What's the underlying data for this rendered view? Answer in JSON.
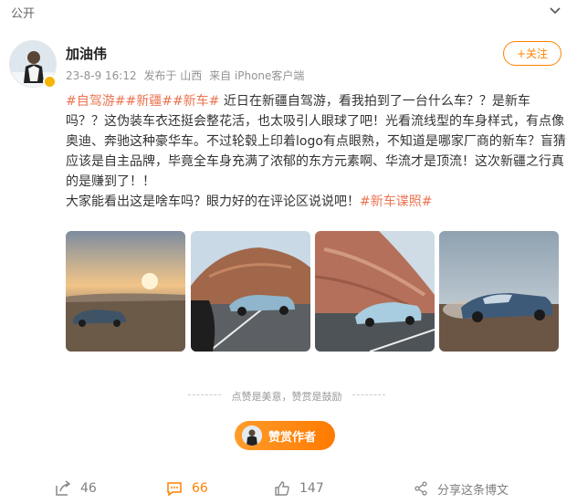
{
  "header": {
    "visibility": "公开"
  },
  "post": {
    "username": "加油伟",
    "timestamp": "23-8-9 16:12",
    "published_in": "发布于 山西",
    "source": "来自 iPhone客户端",
    "follow_label": "+关注",
    "tags": [
      "#自驾游#",
      "#新疆#",
      "#新车#"
    ],
    "body_1": "近日在新疆自驾游，看我拍到了一台什么车？？是新车吗？？这伪装车衣还挺会整花活，也太吸引人眼球了吧！光看流线型的车身样式，有点像奥迪、奔驰这种豪华车。不过轮毂上印着logo有点眼熟，不知道是哪家厂商的新车？盲猜应该是自主品牌，毕竟全车身充满了浓郁的东方元素啊、华流才是顶流！这次新疆之行真的是赚到了！！",
    "body_2": "大家能看出这是啥车吗？眼力好的在评论区说说吧！",
    "end_tag": "#新车谍照#"
  },
  "reward": {
    "divider_text": "点赞是美意，赞赏是鼓励",
    "button_label": "赞赏作者"
  },
  "actions": {
    "share_count": "46",
    "comment_count": "66",
    "like_count": "147",
    "forward_label": "分享这条博文"
  },
  "colors": {
    "accent": "#ff8200",
    "tag": "#eb7350",
    "meta": "#939393"
  },
  "icons": {
    "chevron": "chevron-down-icon",
    "share": "share-icon",
    "comment": "comment-icon",
    "like": "like-icon",
    "forward": "forward-icon"
  }
}
